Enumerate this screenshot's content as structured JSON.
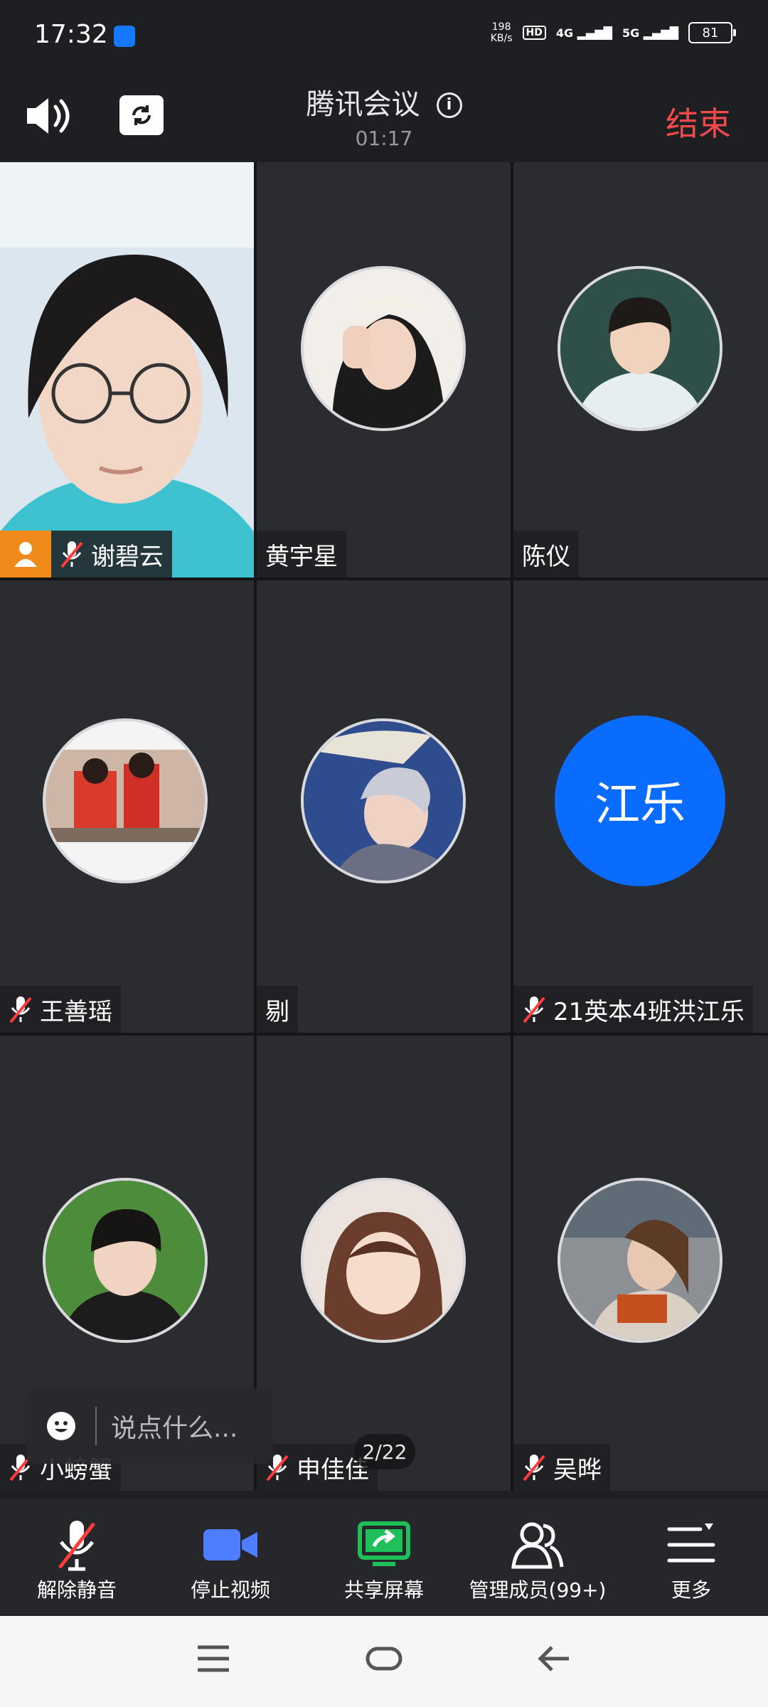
{
  "status_bar": {
    "time": "17:32",
    "net_speed_value": "198",
    "net_speed_unit": "KB/s",
    "hd": "HD",
    "sim1": "4G",
    "sim2": "5G",
    "battery": "81"
  },
  "header": {
    "title": "腾讯会议",
    "timer": "01:17",
    "end_label": "结束",
    "icons": [
      "speaker-icon",
      "switch-camera-icon",
      "info-icon"
    ]
  },
  "participants": [
    {
      "name": "谢碧云",
      "muted": true,
      "host": true,
      "video": true
    },
    {
      "name": "黄宇星",
      "muted": false
    },
    {
      "name": "陈仪",
      "muted": false
    },
    {
      "name": "王善瑶",
      "muted": true
    },
    {
      "name": "剔",
      "muted": false
    },
    {
      "name": "21英本4班洪江乐",
      "muted": true,
      "avatar_text": "江乐",
      "avatar_color": "#0a6cff"
    },
    {
      "name": "小螃蟹",
      "muted": true
    },
    {
      "name": "申佳佳",
      "muted": true
    },
    {
      "name": "吴晔",
      "muted": true
    }
  ],
  "chat": {
    "placeholder": "说点什么..."
  },
  "pagination": {
    "label": "2/22"
  },
  "toolbar": [
    {
      "label": "解除静音",
      "icon": "mic-muted-icon"
    },
    {
      "label": "停止视频",
      "icon": "video-camera-icon"
    },
    {
      "label": "共享屏幕",
      "icon": "share-screen-icon"
    },
    {
      "label": "管理成员(99+)",
      "icon": "members-icon"
    },
    {
      "label": "更多",
      "icon": "more-menu-icon"
    }
  ],
  "nav_bar": {
    "icons": [
      "menu-icon",
      "home-icon",
      "back-icon"
    ]
  },
  "colors": {
    "end": "#f24a4a",
    "host": "#f08b1b",
    "accent": "#0a6cff",
    "share": "#1fbf5a",
    "video": "#4f7dff"
  }
}
